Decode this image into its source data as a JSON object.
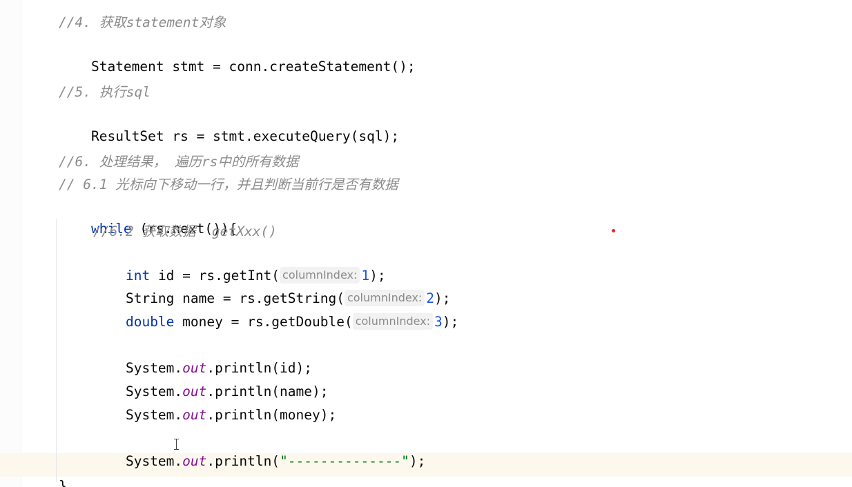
{
  "editor": {
    "lines": {
      "c4": "//4. 获取statement对象",
      "l_stmt": {
        "a": "Statement stmt = conn.createStatement();"
      },
      "c5": "//5. 执行sql",
      "l_rs": {
        "a": "ResultSet rs = stmt.executeQuery(sql);"
      },
      "c6": "//6. 处理结果， 遍历rs中的所有数据",
      "c61": "// 6.1 光标向下移动一行，并且判断当前行是否有数据",
      "l_while": {
        "kw": "while",
        "rest": " (rs.next()){"
      },
      "c62": "//6.2 获取数据  getXxx()",
      "l_id": {
        "kw": "int",
        "a": " id = rs.getInt(",
        "hint": "columnIndex:",
        "num": "1",
        "end": ");"
      },
      "l_name": {
        "a": "String name = rs.getString(",
        "hint": "columnIndex:",
        "num": "2",
        "end": ");"
      },
      "l_money": {
        "kw": "double",
        "a": " money = rs.getDouble(",
        "hint": "columnIndex:",
        "num": "3",
        "end": ");"
      },
      "p1": {
        "a": "System.",
        "field": "out",
        "b": ".println(id);"
      },
      "p2": {
        "a": "System.",
        "field": "out",
        "b": ".println(name);"
      },
      "p3": {
        "a": "System.",
        "field": "out",
        "b": ".println(money);"
      },
      "p4": {
        "a": "System.",
        "field": "out",
        "b": ".println(",
        "str": "\"--------------\"",
        "end": ");"
      },
      "brace": "}"
    },
    "colors": {
      "keyword": "#0033b3",
      "comment": "#8c8c8c",
      "number": "#1750eb",
      "field": "#871094",
      "string": "#067d17",
      "current_line": "#fdf8ee"
    }
  }
}
